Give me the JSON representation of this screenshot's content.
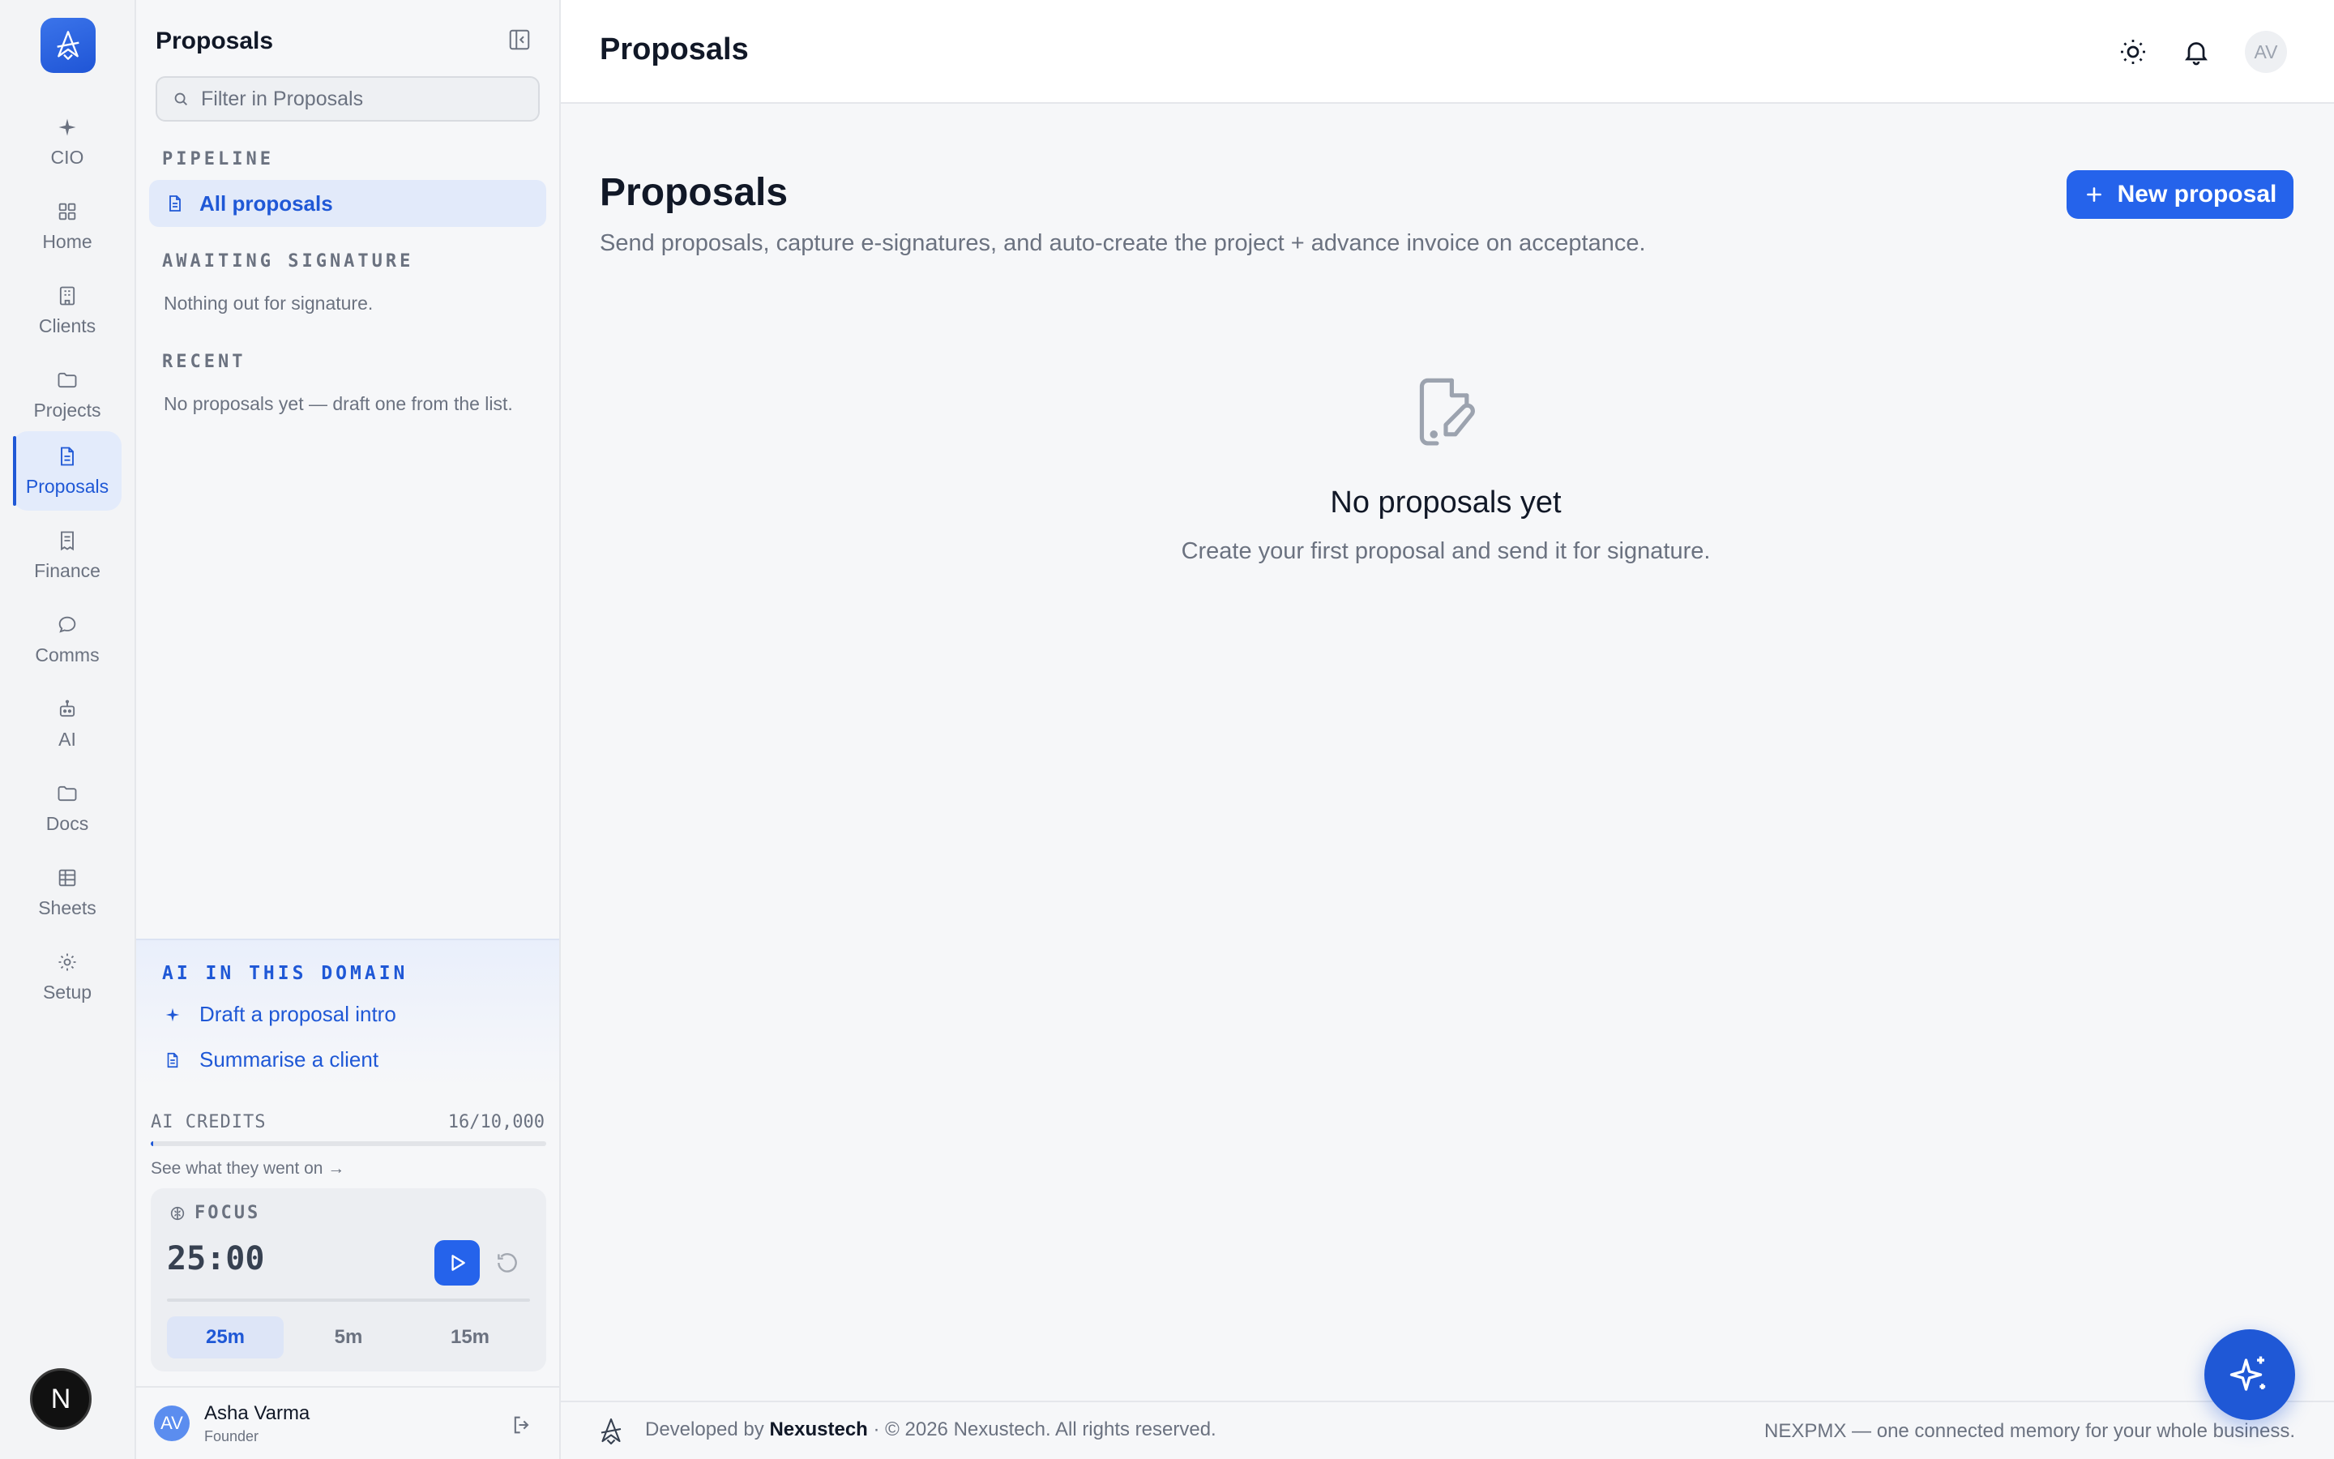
{
  "rail": {
    "items": [
      {
        "label": "CIO",
        "icon": "sparkle-icon"
      },
      {
        "label": "Home",
        "icon": "grid-icon"
      },
      {
        "label": "Clients",
        "icon": "building-icon"
      },
      {
        "label": "Projects",
        "icon": "folder-icon"
      },
      {
        "label": "Proposals",
        "icon": "document-icon",
        "active": true
      },
      {
        "label": "Finance",
        "icon": "receipt-icon"
      },
      {
        "label": "Comms",
        "icon": "chat-icon"
      },
      {
        "label": "AI",
        "icon": "robot-icon"
      },
      {
        "label": "Docs",
        "icon": "folder-icon"
      },
      {
        "label": "Sheets",
        "icon": "table-icon"
      },
      {
        "label": "Setup",
        "icon": "gear-icon"
      }
    ],
    "bottom_badge": "N"
  },
  "sidebar": {
    "title": "Proposals",
    "filter_placeholder": "Filter in Proposals",
    "pipeline_label": "PIPELINE",
    "pipeline_item": "All proposals",
    "awaiting_label": "AWAITING SIGNATURE",
    "awaiting_empty": "Nothing out for signature.",
    "recent_label": "RECENT",
    "recent_empty": "No proposals yet — draft one from the list.",
    "ai": {
      "title": "AI IN THIS DOMAIN",
      "links": [
        "Draft a proposal intro",
        "Summarise a client"
      ]
    },
    "credits": {
      "label": "AI CREDITS",
      "value": "16/10,000",
      "used_fraction": 0.0016,
      "link": "See what they went on →"
    },
    "focus": {
      "label": "FOCUS",
      "time": "25:00",
      "presets": [
        "25m",
        "5m",
        "15m"
      ],
      "active_preset": "25m"
    },
    "user": {
      "initials": "AV",
      "name": "Asha Varma",
      "role": "Founder"
    }
  },
  "topbar": {
    "title": "Proposals",
    "avatar": "AV"
  },
  "main": {
    "heading": "Proposals",
    "subtitle": "Send proposals, capture e-signatures, and auto-create the project + advance invoice on acceptance.",
    "new_button": "New proposal",
    "empty_title": "No proposals yet",
    "empty_desc": "Create your first proposal and send it for signature."
  },
  "footer": {
    "developed_by": "Developed by",
    "company": "Nexustech",
    "copyright": "· © 2026 Nexustech. All rights reserved.",
    "tagline": "NEXPMX — one connected memory for your whole business."
  },
  "colors": {
    "accent": "#1f58d6",
    "button": "#2563eb"
  }
}
